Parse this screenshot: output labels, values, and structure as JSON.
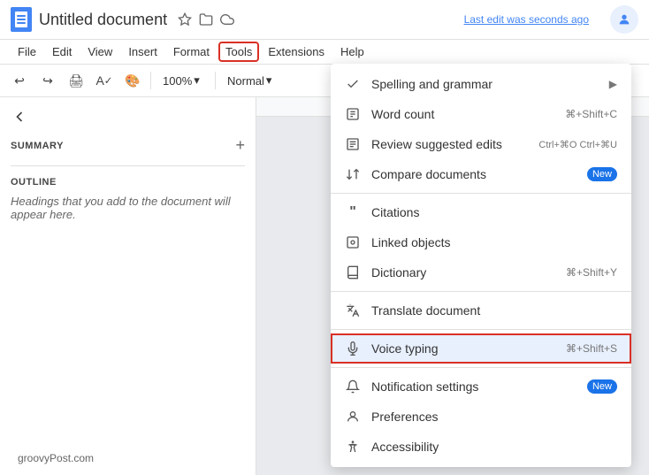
{
  "titlebar": {
    "title": "Untitled document",
    "last_edit": "Last edit was seconds ago"
  },
  "menubar": {
    "items": [
      "File",
      "Edit",
      "View",
      "Insert",
      "Format",
      "Tools",
      "Extensions",
      "Help"
    ]
  },
  "toolbar": {
    "zoom": "100%",
    "style": "Normal"
  },
  "sidebar": {
    "summary_label": "SUMMARY",
    "outline_label": "OUTLINE",
    "outline_desc": "Headings that you add to the document will appear here."
  },
  "dropdown": {
    "items": [
      {
        "id": "spelling",
        "icon": "✓",
        "label": "Spelling and grammar",
        "shortcut": "",
        "has_arrow": true
      },
      {
        "id": "wordcount",
        "icon": "⊞",
        "label": "Word count",
        "shortcut": "⌘+Shift+C",
        "has_arrow": false
      },
      {
        "id": "suggested",
        "icon": "✎",
        "label": "Review suggested edits",
        "shortcut": "Ctrl+⌘O Ctrl+⌘U",
        "has_arrow": false
      },
      {
        "id": "compare",
        "icon": "≈",
        "label": "Compare documents",
        "shortcut": "",
        "badge": "New",
        "has_arrow": false
      },
      {
        "id": "citations",
        "icon": "❝",
        "label": "Citations",
        "shortcut": "",
        "has_arrow": false
      },
      {
        "id": "linked",
        "icon": "⊡",
        "label": "Linked objects",
        "shortcut": "",
        "has_arrow": false
      },
      {
        "id": "dictionary",
        "icon": "📖",
        "label": "Dictionary",
        "shortcut": "⌘+Shift+Y",
        "has_arrow": false
      },
      {
        "id": "translate",
        "icon": "Xā",
        "label": "Translate document",
        "shortcut": "",
        "has_arrow": false
      },
      {
        "id": "voice",
        "icon": "🎤",
        "label": "Voice typing",
        "shortcut": "⌘+Shift+S",
        "has_arrow": false,
        "highlighted": true
      },
      {
        "id": "notifications",
        "icon": "🔔",
        "label": "Notification settings",
        "shortcut": "",
        "badge": "New",
        "has_arrow": false
      },
      {
        "id": "preferences",
        "icon": "👤",
        "label": "Preferences",
        "shortcut": "",
        "has_arrow": false
      },
      {
        "id": "accessibility",
        "icon": "♿",
        "label": "Accessibility",
        "shortcut": "",
        "has_arrow": false
      }
    ]
  },
  "watermark": "groovyPost.com"
}
